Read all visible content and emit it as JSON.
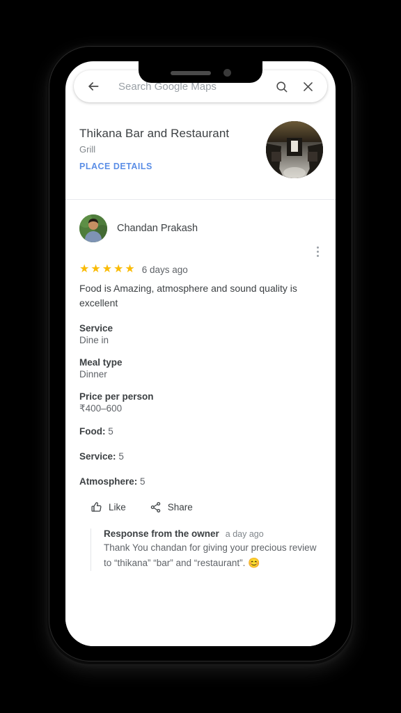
{
  "device": {
    "buttons": {
      "silent_switch": "silent-switch",
      "volume_up": "volume-up-button",
      "volume_down": "volume-down-button",
      "power": "power-button"
    }
  },
  "search": {
    "placeholder": "Search Google Maps",
    "back_icon": "back-arrow-icon",
    "search_icon": "search-icon",
    "close_icon": "close-icon"
  },
  "place": {
    "name": "Thikana Bar and Restaurant",
    "category": "Grill",
    "details_link": "PLACE DETAILS"
  },
  "review": {
    "reviewer_name": "Chandan Prakash",
    "rating": 5,
    "stars": [
      "★",
      "★",
      "★",
      "★",
      "★"
    ],
    "star_color": "#fabb05",
    "time_ago": "6 days ago",
    "text": "Food is Amazing, atmosphere and sound quality is excellent",
    "attributes": [
      {
        "label": "Service",
        "value": "Dine in"
      },
      {
        "label": "Meal type",
        "value": "Dinner"
      },
      {
        "label": "Price per person",
        "value": "₹400–600"
      }
    ],
    "scores": [
      {
        "label": "Food:",
        "value": "5"
      },
      {
        "label": "Service:",
        "value": "5"
      },
      {
        "label": "Atmosphere:",
        "value": "5"
      }
    ],
    "actions": {
      "like_label": "Like",
      "share_label": "Share"
    },
    "owner_response": {
      "title": "Response from the owner",
      "time_ago": "a day ago",
      "text": "Thank You chandan for giving your precious review to “thikana” “bar” and “restaurant”.",
      "emoji": "😊"
    }
  },
  "colors": {
    "link_blue": "#5b8ee6",
    "star_gold": "#fabb05",
    "text_primary": "#3c4043",
    "text_secondary": "#5f6368"
  }
}
